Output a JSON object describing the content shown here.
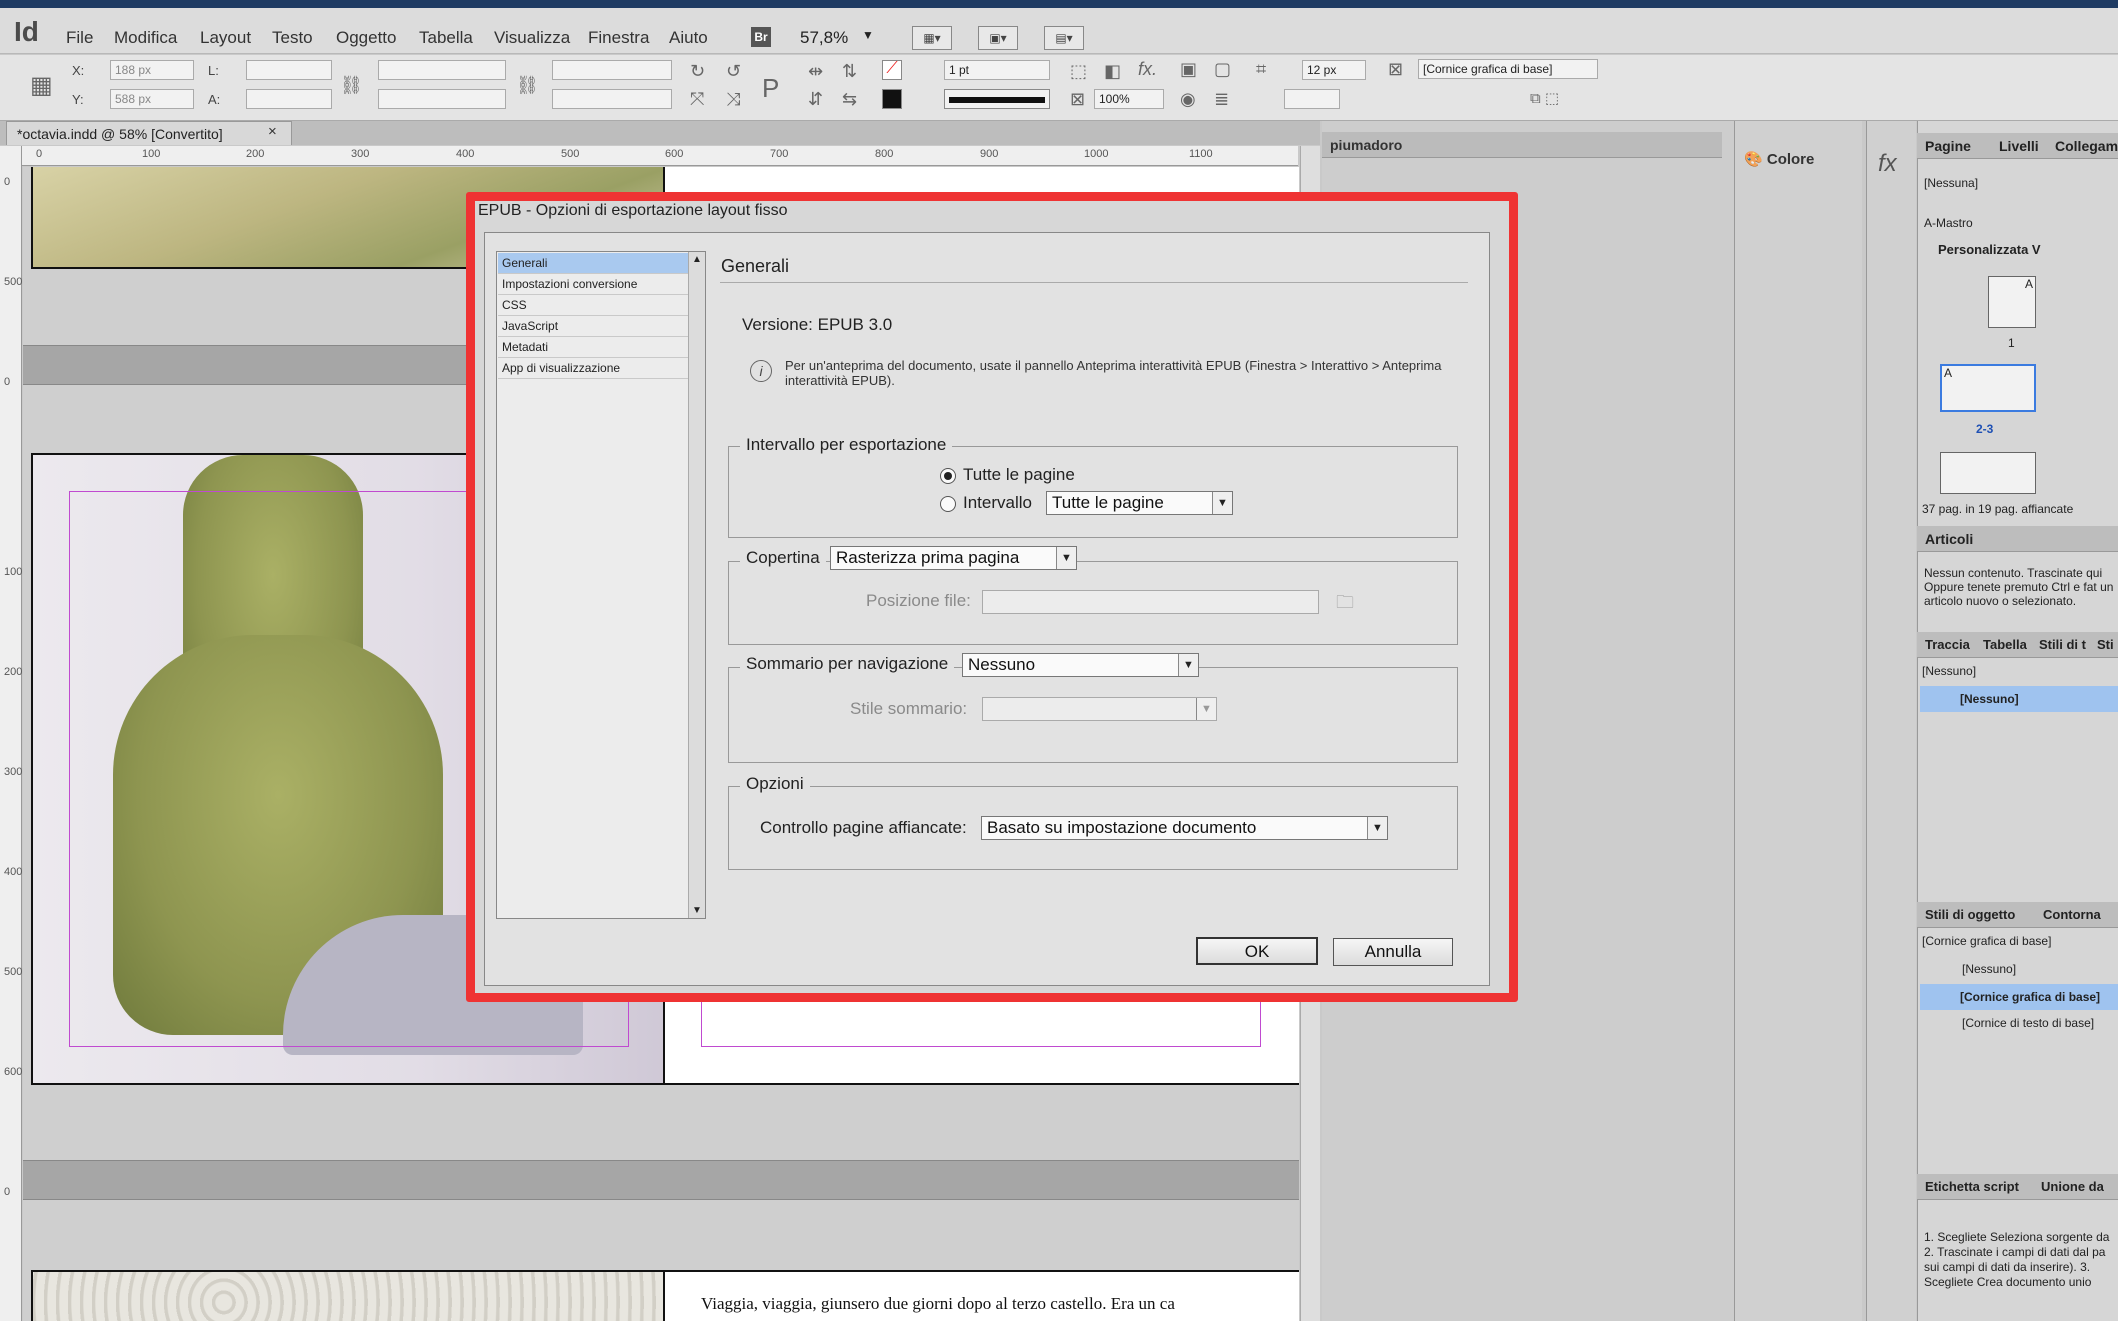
{
  "app": {
    "logo": "Id",
    "menu": [
      "File",
      "Modifica",
      "Layout",
      "Testo",
      "Oggetto",
      "Tabella",
      "Visualizza",
      "Finestra",
      "Aiuto"
    ],
    "bridge": "Br",
    "zoom": "57,8%"
  },
  "controls": {
    "x_label": "X:",
    "x_value": "188 px",
    "y_label": "Y:",
    "y_value": "588 px",
    "l_label": "L:",
    "a_label": "A:",
    "stroke_weight": "1 pt",
    "opacity": "100%",
    "offset": "12 px",
    "frame_style": "[Cornice grafica di base]"
  },
  "document": {
    "tab_title": "*octavia.indd @ 58% [Convertito]",
    "close": "×",
    "ruler_h": [
      "0",
      "100",
      "200",
      "300",
      "400",
      "500",
      "600",
      "700",
      "800",
      "900",
      "1000",
      "1100"
    ],
    "ruler_v": [
      "0",
      "500",
      "0",
      "100",
      "200",
      "300",
      "400",
      "500",
      "600",
      "0"
    ],
    "body_text": "Viaggia, viaggia, giunsero due giorni dopo al terzo castello. Era un ca"
  },
  "mid_panel": {
    "title": "piumadoro"
  },
  "color_panel": {
    "label": "Colore",
    "fx": "fx"
  },
  "pages_panel": {
    "tabs": [
      "Pagine",
      "Livelli",
      "Collegam"
    ],
    "none": "[Nessuna]",
    "master": "A-Mastro",
    "custom": "Personalizzata V",
    "page1": "1",
    "spread": "2-3",
    "count": "37 pag. in 19 pag. affiancate",
    "master_mark": "A"
  },
  "articles_panel": {
    "tab": "Articoli",
    "text": "Nessun contenuto. Trascinate qui Oppure tenete premuto Ctrl e fat un articolo nuovo o selezionato."
  },
  "trace_panel": {
    "tabs": [
      "Traccia",
      "Tabella",
      "Stili di t",
      "Sti"
    ],
    "none": "[Nessuno]",
    "selected": "[Nessuno]"
  },
  "object_styles_panel": {
    "tabs": [
      "Stili di oggetto",
      "Contorna"
    ],
    "current": "[Cornice grafica di base]",
    "items": [
      "[Nessuno]",
      "[Cornice grafica di base]",
      "[Cornice di testo di base]"
    ]
  },
  "script_panel": {
    "tabs": [
      "Etichetta script",
      "Unione da"
    ],
    "text": "1. Scegliete Seleziona sorgente da 2. Trascinate i campi di dati dal pa sui campi di dati da inserire). 3. Scegliete Crea documento unio"
  },
  "dialog": {
    "title": "EPUB - Opzioni di esportazione layout fisso",
    "nav": [
      "Generali",
      "Impostazioni conversione",
      "CSS",
      "JavaScript",
      "Metadati",
      "App di visualizzazione"
    ],
    "heading": "Generali",
    "version": "Versione: EPUB 3.0",
    "info_icon": "i",
    "info": "Per un'anteprima del documento, usate il pannello Anteprima interattività EPUB (Finestra > Interattivo > Anteprima interattività EPUB).",
    "range": {
      "title": "Intervallo per esportazione",
      "all": "Tutte le pagine",
      "range": "Intervallo",
      "range_value": "Tutte le pagine"
    },
    "cover": {
      "title": "Copertina",
      "value": "Rasterizza prima pagina",
      "file_label": "Posizione file:"
    },
    "toc": {
      "title": "Sommario per navigazione",
      "value": "Nessuno",
      "style_label": "Stile sommario:"
    },
    "options": {
      "title": "Opzioni",
      "spread_label": "Controllo pagine affiancate:",
      "spread_value": "Basato su impostazione documento"
    },
    "ok": "OK",
    "cancel": "Annulla"
  },
  "colors": {
    "accent": "#ef3333",
    "selection": "#9fc3ef",
    "menubar": "#dcdcdc",
    "titlebar": "#1f3b63"
  }
}
